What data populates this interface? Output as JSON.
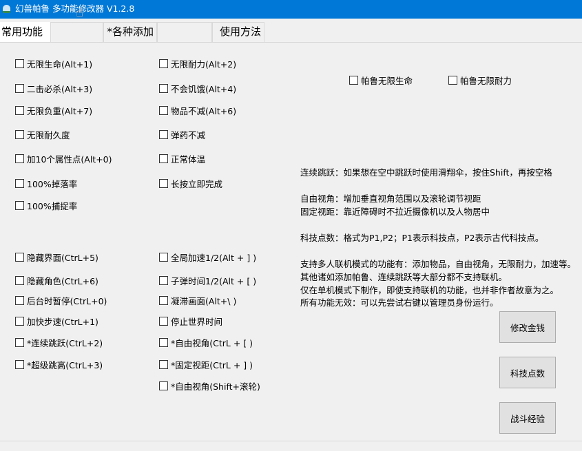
{
  "window": {
    "title": "幻兽帕鲁 多功能修改器  V1.2.8"
  },
  "tabs": [
    "常用功能",
    "",
    "*各种添加",
    "",
    "使用方法"
  ],
  "left_col1": [
    "无限生命(Alt+1)",
    "二击必杀(Alt+3)",
    "无限负重(Alt+7)",
    "无限耐久度",
    "加10个属性点(Alt+0)",
    "100%掉落率",
    "100%捕捉率"
  ],
  "right_col1": [
    "无限耐力(Alt+2)",
    "不会饥饿(Alt+4)",
    "物品不减(Alt+6)",
    "弹药不减",
    "正常体温",
    "长按立即完成"
  ],
  "left_col2": [
    "隐藏界面(CtrL+5)",
    "隐藏角色(CtrL+6)",
    "后台时暂停(CtrL+0)",
    "加快步速(CtrL+1)",
    "*连续跳跃(CtrL+2)",
    "*超级跳高(CtrL+3)"
  ],
  "right_col2": [
    "全局加速1/2(Alt + ] )",
    "子弹时间1/2(Alt + [ )",
    "凝滞画面(Alt+\\ )",
    "停止世界时间",
    "*自由视角(CtrL + [ )",
    "*固定视距(CtrL + ] )",
    "*自由视角(Shift+滚轮)"
  ],
  "palu": [
    "帕鲁无限生命",
    "帕鲁无限耐力"
  ],
  "notes": [
    "连续跳跃：如果想在空中跳跃时使用滑翔伞，按住Shift，再按空格",
    "自由视角：增加垂直视角范围以及滚轮调节视距",
    "固定视距：靠近障碍时不拉近摄像机以及人物居中",
    "科技点数：格式为P1,P2；P1表示科技点，P2表示古代科技点。",
    "支持多人联机模式的功能有：添加物品，自由视角，无限耐力，加速等。",
    "其他诸如添加帕鲁、连续跳跃等大部分都不支持联机。",
    "仅在单机模式下制作，即使支持联机的功能，也并非作者故意为之。",
    "所有功能无效：可以先尝试右键以管理员身份运行。"
  ],
  "buttons": [
    "修改金钱",
    "科技点数",
    "战斗经验"
  ]
}
